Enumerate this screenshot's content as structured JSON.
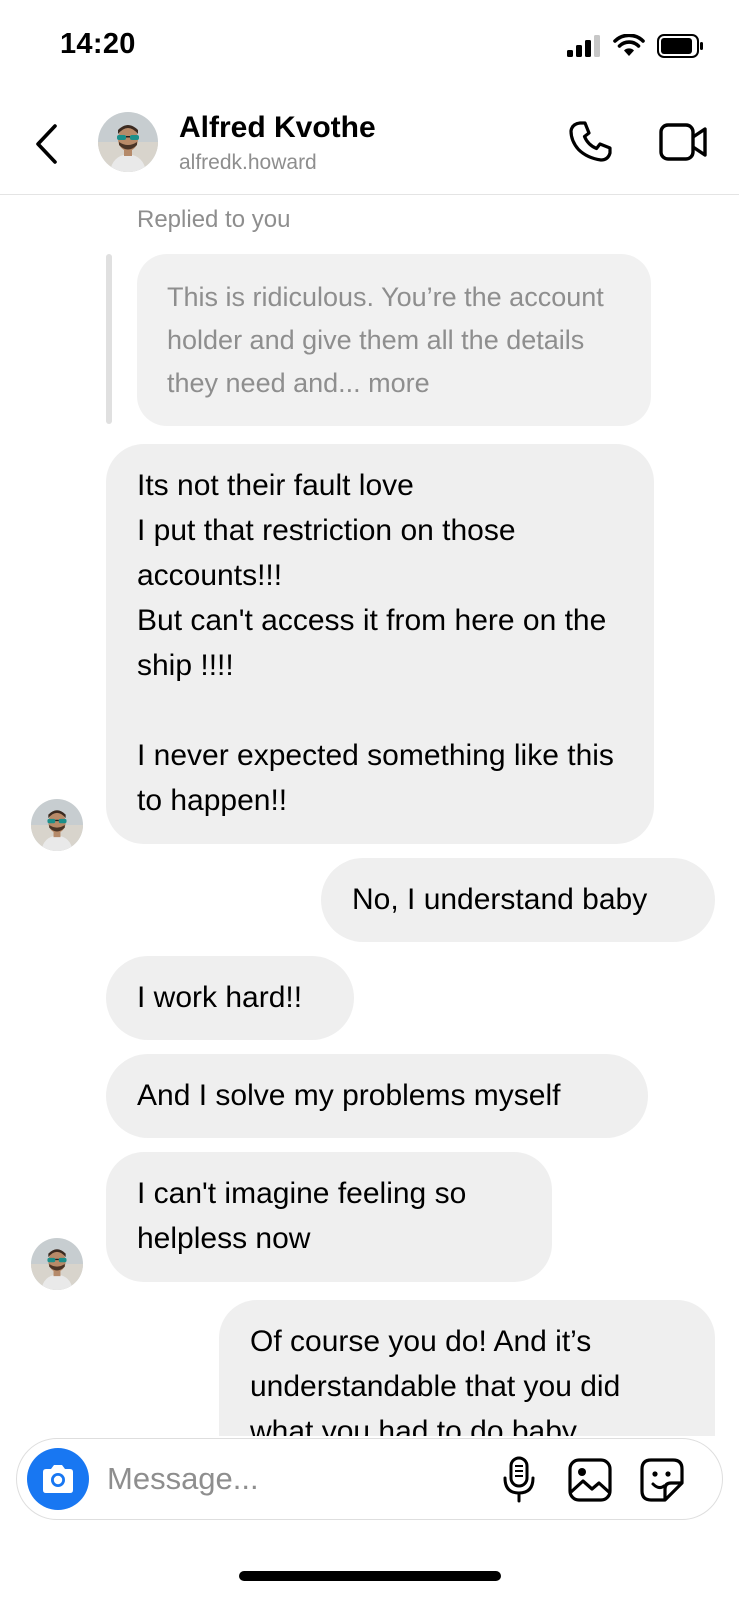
{
  "status_bar": {
    "time": "14:20"
  },
  "header": {
    "contact_name": "Alfred Kvothe",
    "contact_handle": "alfredk.howard"
  },
  "thread": {
    "replied_label": "Replied to you",
    "quoted_message": "This is ridiculous. You’re the account holder and give them all the details they need and... more",
    "messages": [
      {
        "sender": "them",
        "text": "Its not their fault love\nI put that restriction on those accounts!!!\nBut can't access it from here on the ship !!!!\n\nI never expected something like this to happen!!"
      },
      {
        "sender": "me",
        "text": "No, I understand baby"
      },
      {
        "sender": "them",
        "text": "I work hard!!"
      },
      {
        "sender": "them",
        "text": "And I solve my problems myself"
      },
      {
        "sender": "them",
        "text": "I can't imagine feeling so helpless now"
      },
      {
        "sender": "me",
        "text": "Of course you do! And it’s understandable that you did what you had to do baby"
      }
    ]
  },
  "composer": {
    "placeholder": "Message..."
  },
  "colors": {
    "accent": "#1877f2",
    "bubble": "#efefef",
    "muted_text": "#8e8e8e"
  },
  "icons": {
    "back": "chevron-left-icon",
    "call": "phone-icon",
    "video": "video-camera-icon",
    "camera": "camera-icon",
    "mic": "microphone-icon",
    "gallery": "image-icon",
    "sticker": "sticker-icon"
  }
}
